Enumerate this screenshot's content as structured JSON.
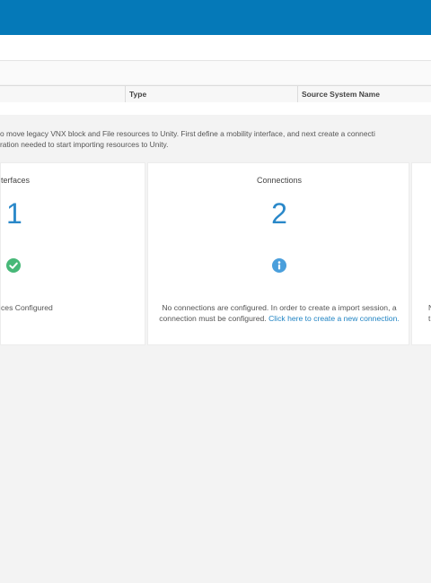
{
  "table": {
    "columns": [
      "",
      "Type",
      "Source System Name"
    ]
  },
  "intro": {
    "line1": "o move legacy VNX block and File resources to Unity. First define a mobility interface, and next create a connecti",
    "line2": "ration needed to start importing resources to Unity."
  },
  "cards": {
    "interfaces": {
      "title": "terfaces",
      "count": "1",
      "status_icon": "check-circle-icon",
      "message": "ces Configured"
    },
    "connections": {
      "title": "Connections",
      "count": "2",
      "status_icon": "info-circle-icon",
      "message": "No connections are configured. In order to create a import session, a connection must be configured.",
      "link": "Click here to create a new connection."
    },
    "third": {
      "message_line1": "N",
      "message_line2": "t"
    }
  },
  "colors": {
    "header_blue": "#0579b8",
    "count_blue": "#2a88c9",
    "ok_green": "#47b878",
    "info_blue": "#4a9fdc",
    "link_blue": "#1f83c3"
  }
}
